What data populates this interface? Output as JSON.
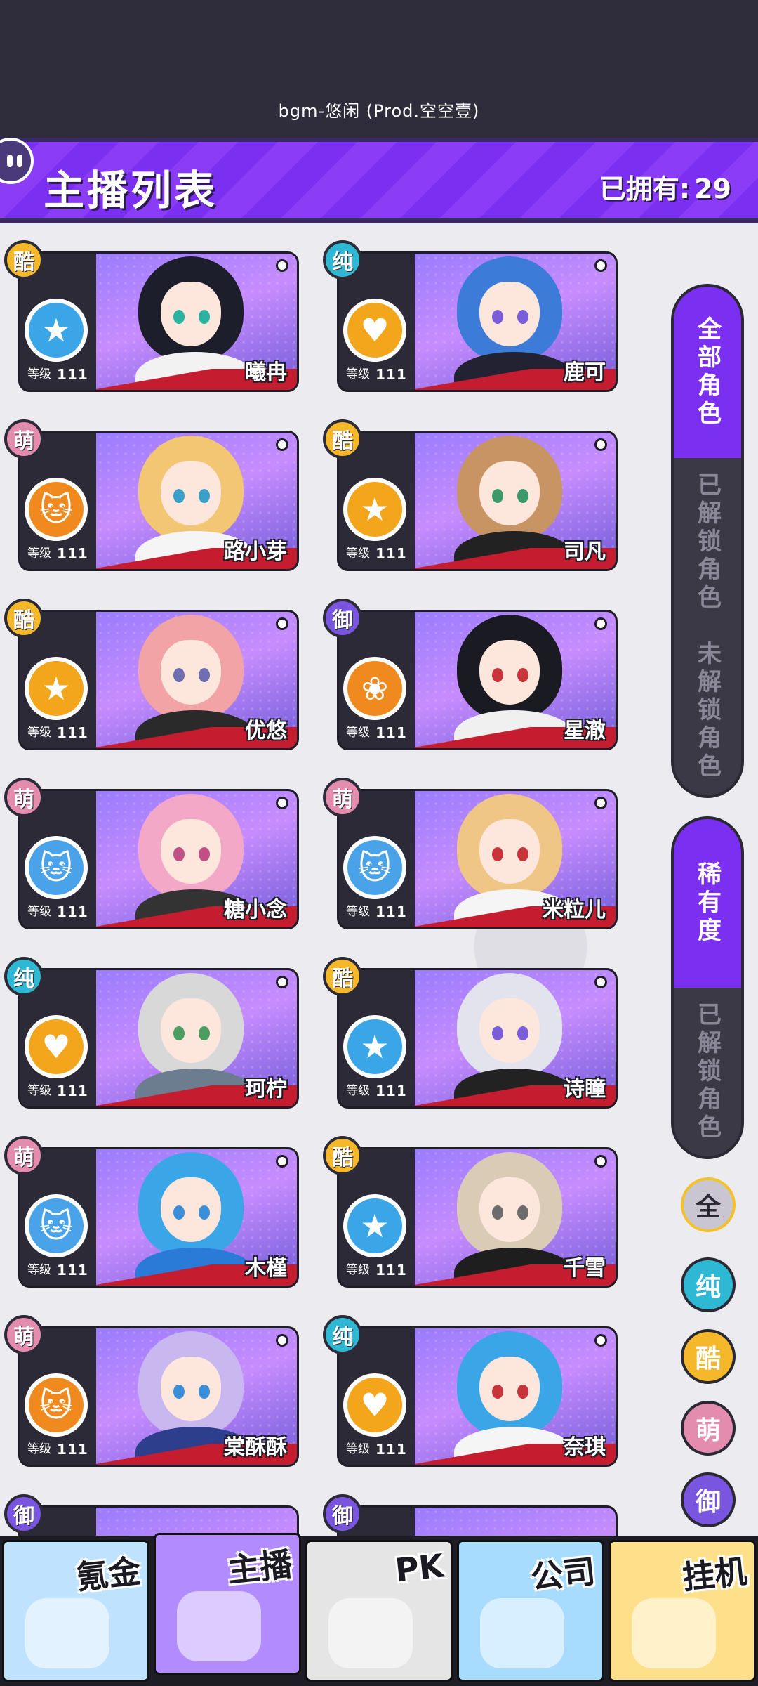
{
  "status": {
    "bgm": "bgm-悠闲 (Prod.空空壹)"
  },
  "header": {
    "title": "主播列表",
    "owned_label": "已拥有:",
    "owned_count": "29"
  },
  "cards": [
    {
      "name": "曦冉",
      "rarity": "酷",
      "rarity_class": "r-cool",
      "team_symbol": "★",
      "team_color": "#3aa6e8",
      "level_label": "等级",
      "level": "111",
      "hair": "#1c1f2b",
      "eye": "#2bb3a0",
      "body": "#f2f2f2"
    },
    {
      "name": "鹿可",
      "rarity": "纯",
      "rarity_class": "r-pure",
      "team_symbol": "♥",
      "team_color": "#f3a51c",
      "level_label": "等级",
      "level": "111",
      "hair": "#3c7bd8",
      "eye": "#7a5dd8",
      "body": "#222233"
    },
    {
      "name": "路小芽",
      "rarity": "萌",
      "rarity_class": "r-cute",
      "team_symbol": "🐱",
      "team_color": "#f08a1e",
      "level_label": "等级",
      "level": "111",
      "hair": "#f3c674",
      "eye": "#3aa0c8",
      "body": "#f5f5f5"
    },
    {
      "name": "司凡",
      "rarity": "酷",
      "rarity_class": "r-cool",
      "team_symbol": "★",
      "team_color": "#f3a51c",
      "level_label": "等级",
      "level": "111",
      "hair": "#c99463",
      "eye": "#3c9a6a",
      "body": "#222222"
    },
    {
      "name": "优悠",
      "rarity": "酷",
      "rarity_class": "r-cool",
      "team_symbol": "★",
      "team_color": "#f3a51c",
      "level_label": "等级",
      "level": "111",
      "hair": "#f2a3a6",
      "eye": "#6f6fb0",
      "body": "#2a2a2a"
    },
    {
      "name": "星澈",
      "rarity": "御",
      "rarity_class": "r-royal",
      "team_symbol": "❀",
      "team_color": "#f08a1e",
      "level_label": "等级",
      "level": "111",
      "hair": "#1a1a22",
      "eye": "#c7343a",
      "body": "#f0f0f0"
    },
    {
      "name": "糖小念",
      "rarity": "萌",
      "rarity_class": "r-cute",
      "team_symbol": "🐱",
      "team_color": "#4aa3e8",
      "level_label": "等级",
      "level": "111",
      "hair": "#f3a8c8",
      "eye": "#c04f86",
      "body": "#333333"
    },
    {
      "name": "米粒儿",
      "rarity": "萌",
      "rarity_class": "r-cute",
      "team_symbol": "🐱",
      "team_color": "#4aa3e8",
      "level_label": "等级",
      "level": "111",
      "hair": "#f0c686",
      "eye": "#c7343a",
      "body": "#f5f5f5"
    },
    {
      "name": "珂柠",
      "rarity": "纯",
      "rarity_class": "r-pure",
      "team_symbol": "♥",
      "team_color": "#f3a51c",
      "level_label": "等级",
      "level": "111",
      "hair": "#d8d8d8",
      "eye": "#4c9e60",
      "body": "#6d7d90"
    },
    {
      "name": "诗瞳",
      "rarity": "酷",
      "rarity_class": "r-cool",
      "team_symbol": "★",
      "team_color": "#3aa6e8",
      "level_label": "等级",
      "level": "111",
      "hair": "#e3e3ee",
      "eye": "#7a5dd8",
      "body": "#222222"
    },
    {
      "name": "木槿",
      "rarity": "萌",
      "rarity_class": "r-cute",
      "team_symbol": "🐱",
      "team_color": "#4aa3e8",
      "level_label": "等级",
      "level": "111",
      "hair": "#3aa6e8",
      "eye": "#3a8fd8",
      "body": "#2a7ad8"
    },
    {
      "name": "千雪",
      "rarity": "酷",
      "rarity_class": "r-cool",
      "team_symbol": "★",
      "team_color": "#3aa6e8",
      "level_label": "等级",
      "level": "111",
      "hair": "#d9cbb5",
      "eye": "#6b6b6b",
      "body": "#1e1e1e"
    },
    {
      "name": "棠酥酥",
      "rarity": "萌",
      "rarity_class": "r-cute",
      "team_symbol": "🐱",
      "team_color": "#f08a1e",
      "level_label": "等级",
      "level": "111",
      "hair": "#c9b8f0",
      "eye": "#3a8fd8",
      "body": "#2c3e8c"
    },
    {
      "name": "奈琪",
      "rarity": "纯",
      "rarity_class": "r-pure",
      "team_symbol": "♥",
      "team_color": "#f3a51c",
      "level_label": "等级",
      "level": "111",
      "hair": "#3aa6e8",
      "eye": "#c7343a",
      "body": "#f5f5f5"
    }
  ],
  "partial_cards": [
    {
      "rarity": "御",
      "rarity_class": "r-royal"
    },
    {
      "rarity": "御",
      "rarity_class": "r-royal"
    }
  ],
  "filters": {
    "group1": [
      {
        "label": "全部角色",
        "active": true
      },
      {
        "label": "已解锁角色",
        "active": false
      },
      {
        "label": "未解锁角色",
        "active": false
      }
    ],
    "group2": [
      {
        "label": "稀有度",
        "active": true
      },
      {
        "label": "已解锁角色",
        "active": false
      }
    ],
    "circles": [
      {
        "label": "全",
        "color": "#c9c6d2",
        "ring": "#f3c22a"
      },
      {
        "label": "纯",
        "color": "#2fb8d4",
        "ring": "#2a2833"
      },
      {
        "label": "酷",
        "color": "#f5b82a",
        "ring": "#2a2833"
      },
      {
        "label": "萌",
        "color": "#e38cae",
        "ring": "#2a2833"
      },
      {
        "label": "御",
        "color": "#7a55e0",
        "ring": "#2a2833"
      }
    ]
  },
  "nav": [
    {
      "label": "氪金",
      "bg": "#bfe3ff",
      "active": false
    },
    {
      "label": "主播",
      "bg": "#b28cff",
      "active": true
    },
    {
      "label": "PK",
      "bg": "#e5e5e5",
      "active": false
    },
    {
      "label": "公司",
      "bg": "#a8dcff",
      "active": false
    },
    {
      "label": "挂机",
      "bg": "#ffe08a",
      "active": false
    }
  ]
}
